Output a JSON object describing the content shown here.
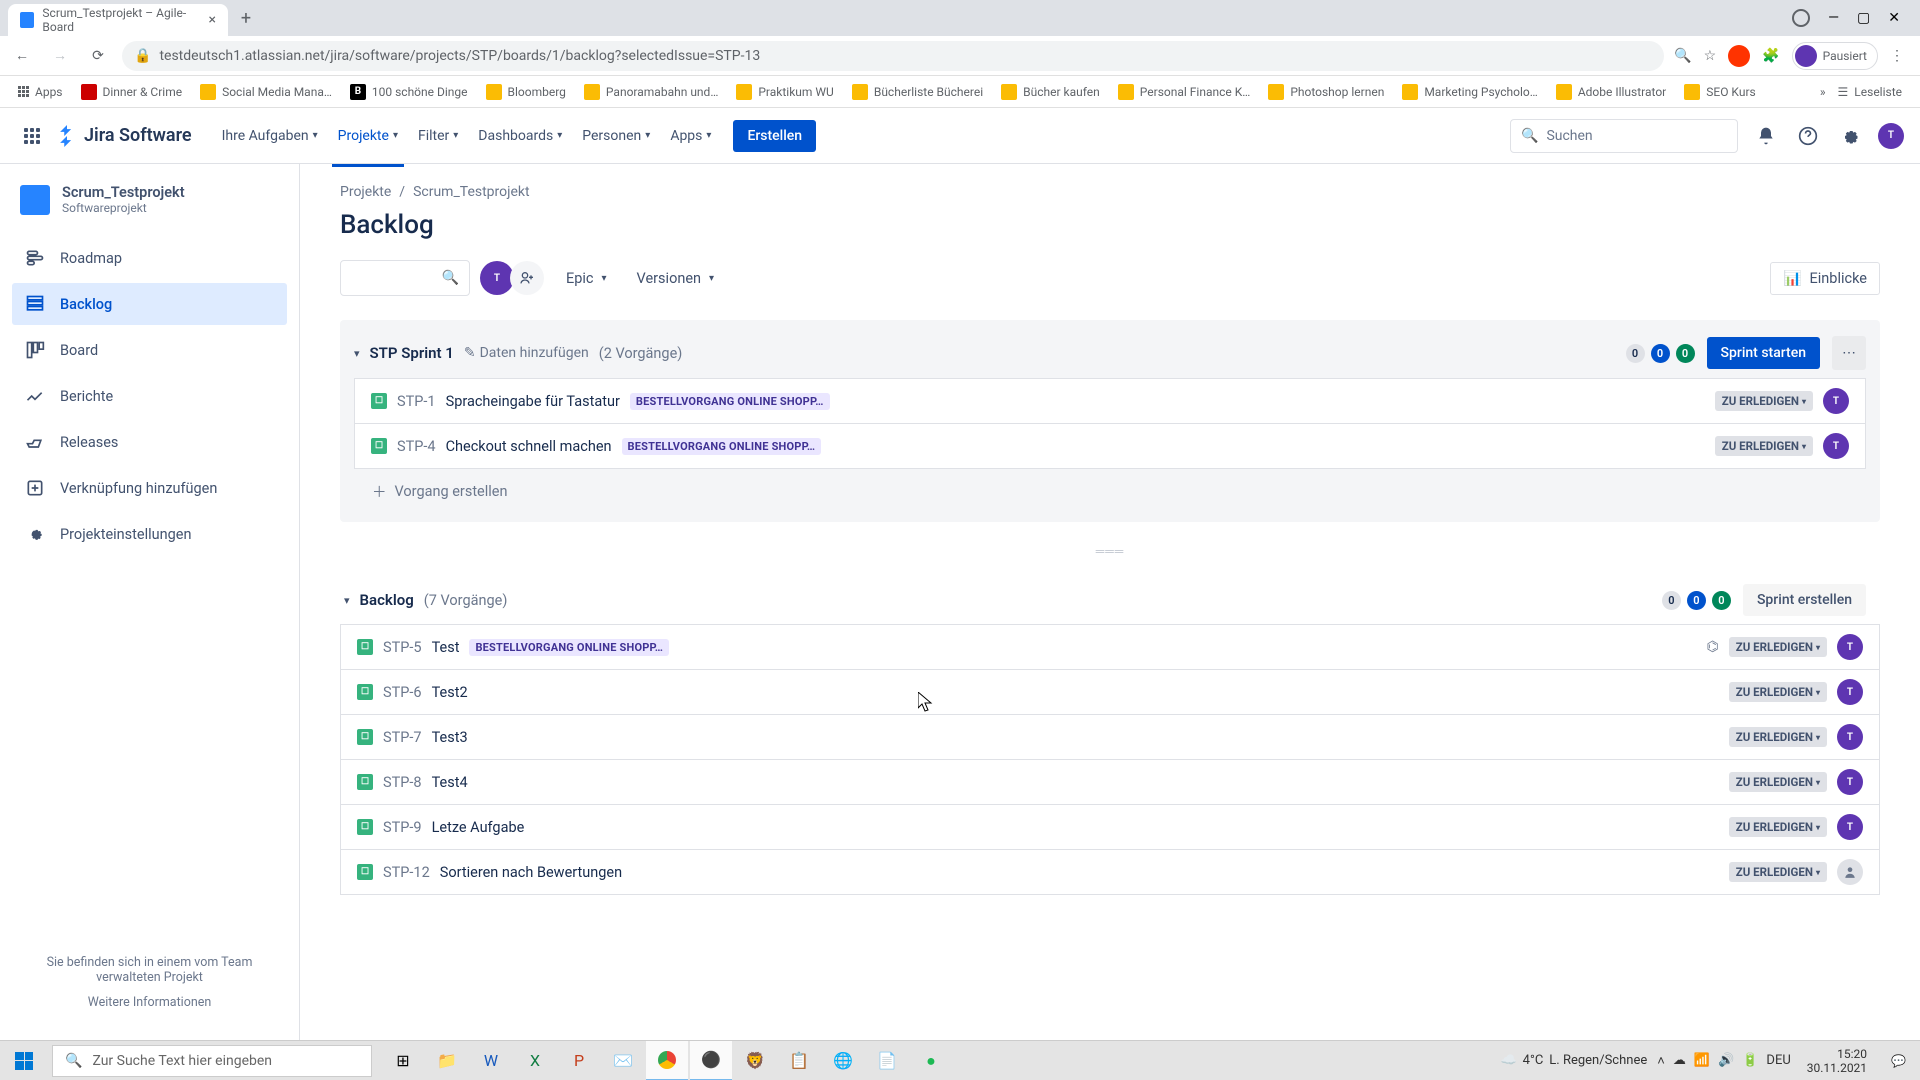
{
  "browser": {
    "tab_title": "Scrum_Testprojekt – Agile-Board",
    "url": "testdeutsch1.atlassian.net/jira/software/projects/STP/boards/1/backlog?selectedIssue=STP-13",
    "profile_status": "Pausiert"
  },
  "bookmarks": [
    "Apps",
    "Dinner & Crime",
    "Social Media Mana…",
    "100 schöne Dinge",
    "Bloomberg",
    "Panoramabahn und…",
    "Praktikum WU",
    "Bücherliste Bücherei",
    "Bücher kaufen",
    "Personal Finance K…",
    "Photoshop lernen",
    "Marketing Psycholo…",
    "Adobe Illustrator",
    "SEO Kurs",
    "Leseliste"
  ],
  "jira": {
    "product": "Jira Software",
    "nav": {
      "your_work": "Ihre Aufgaben",
      "projects": "Projekte",
      "filters": "Filter",
      "dashboards": "Dashboards",
      "people": "Personen",
      "apps": "Apps",
      "create": "Erstellen"
    },
    "search_placeholder": "Suchen",
    "avatar_letter": "T"
  },
  "sidebar": {
    "project_name": "Scrum_Testprojekt",
    "project_type": "Softwareprojekt",
    "items": {
      "roadmap": "Roadmap",
      "backlog": "Backlog",
      "board": "Board",
      "reports": "Berichte",
      "releases": "Releases",
      "link": "Verknüpfung hinzufügen",
      "settings": "Projekteinstellungen"
    },
    "footer_text": "Sie befinden sich in einem vom Team verwalteten Projekt",
    "footer_link": "Weitere Informationen"
  },
  "main": {
    "breadcrumb_root": "Projekte",
    "breadcrumb_project": "Scrum_Testprojekt",
    "title": "Backlog",
    "filter_epic": "Epic",
    "filter_versions": "Versionen",
    "insights": "Einblicke",
    "sprint": {
      "name": "STP Sprint 1",
      "add_dates": "Daten hinzufügen",
      "count": "(2 Vorgänge)",
      "start_button": "Sprint starten",
      "badges": {
        "todo": "0",
        "inprog": "0",
        "done": "0"
      },
      "issues": [
        {
          "key": "STP-1",
          "summary": "Spracheingabe für Tastatur",
          "epic": "BESTELLVORGANG ONLINE SHOPP…",
          "status": "ZU ERLEDIGEN",
          "assignee": "T"
        },
        {
          "key": "STP-4",
          "summary": "Checkout schnell machen",
          "epic": "BESTELLVORGANG ONLINE SHOPP…",
          "status": "ZU ERLEDIGEN",
          "assignee": "T"
        }
      ],
      "create_issue": "Vorgang erstellen"
    },
    "backlog": {
      "name": "Backlog",
      "count": "(7 Vorgänge)",
      "create_button": "Sprint erstellen",
      "badges": {
        "todo": "0",
        "inprog": "0",
        "done": "0"
      },
      "issues": [
        {
          "key": "STP-5",
          "summary": "Test",
          "epic": "BESTELLVORGANG ONLINE SHOPP…",
          "status": "ZU ERLEDIGEN",
          "assignee": "T",
          "has_child": true
        },
        {
          "key": "STP-6",
          "summary": "Test2",
          "status": "ZU ERLEDIGEN",
          "assignee": "T"
        },
        {
          "key": "STP-7",
          "summary": "Test3",
          "status": "ZU ERLEDIGEN",
          "assignee": "T"
        },
        {
          "key": "STP-8",
          "summary": "Test4",
          "status": "ZU ERLEDIGEN",
          "assignee": "T"
        },
        {
          "key": "STP-9",
          "summary": "Letze Aufgabe",
          "status": "ZU ERLEDIGEN",
          "assignee": "T"
        },
        {
          "key": "STP-12",
          "summary": "Sortieren nach Bewertungen",
          "status": "ZU ERLEDIGEN",
          "assignee": ""
        }
      ]
    }
  },
  "taskbar": {
    "search_placeholder": "Zur Suche Text hier eingeben",
    "weather_temp": "4°C",
    "weather_text": "L. Regen/Schnee",
    "lang": "DEU",
    "time": "15:20",
    "date": "30.11.2021"
  }
}
